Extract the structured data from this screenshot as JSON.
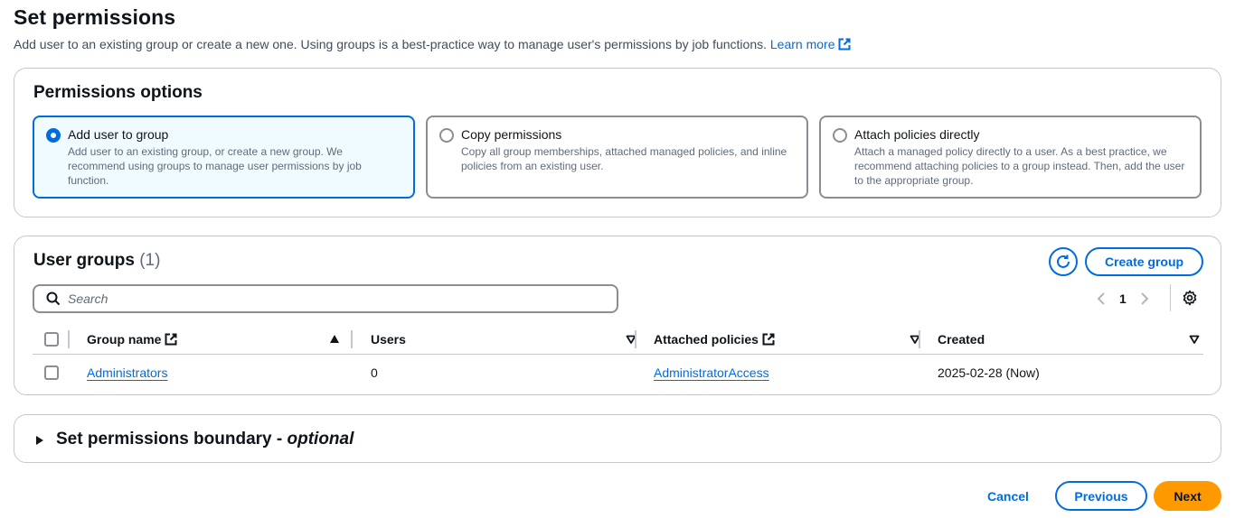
{
  "page": {
    "title": "Set permissions",
    "description": "Add user to an existing group or create a new one. Using groups is a best-practice way to manage user's permissions by job functions.",
    "learn_more": "Learn more"
  },
  "permissions_options": {
    "title": "Permissions options",
    "selected_option": "Add user to group",
    "options": [
      {
        "label": "Add user to group",
        "description": "Add user to an existing group, or create a new group. We recommend using groups to manage user permissions by job function.",
        "selected": true
      },
      {
        "label": "Copy permissions",
        "description": "Copy all group memberships, attached managed policies, and inline policies from an existing user.",
        "selected": false
      },
      {
        "label": "Attach policies directly",
        "description": "Attach a managed policy directly to a user. As a best practice, we recommend attaching policies to a group instead. Then, add the user to the appropriate group.",
        "selected": false
      }
    ]
  },
  "user_groups": {
    "title": "User groups",
    "count": "(1)",
    "create_button": "Create group",
    "search_placeholder": "Search",
    "current_page": "1",
    "columns": [
      {
        "label": "Group name",
        "external_link": true,
        "sort": "ascending"
      },
      {
        "label": "Users",
        "sort": "none"
      },
      {
        "label": "Attached policies",
        "external_link": true,
        "sort": "none"
      },
      {
        "label": "Created",
        "sort": "none"
      }
    ],
    "rows": [
      {
        "group_name": "Administrators",
        "users": "0",
        "attached_policies": "AdministratorAccess",
        "created": "2025-02-28 (Now)"
      }
    ]
  },
  "boundary": {
    "title": "Set permissions boundary - ",
    "title_optional": "optional",
    "expanded": false
  },
  "footer": {
    "cancel": "Cancel",
    "previous": "Previous",
    "next": "Next"
  },
  "colors": {
    "accent": "#006ce0",
    "primary_button": "#ff9900",
    "selected_tile_bg": "#f0fbff",
    "border": "#c6c6cd"
  }
}
